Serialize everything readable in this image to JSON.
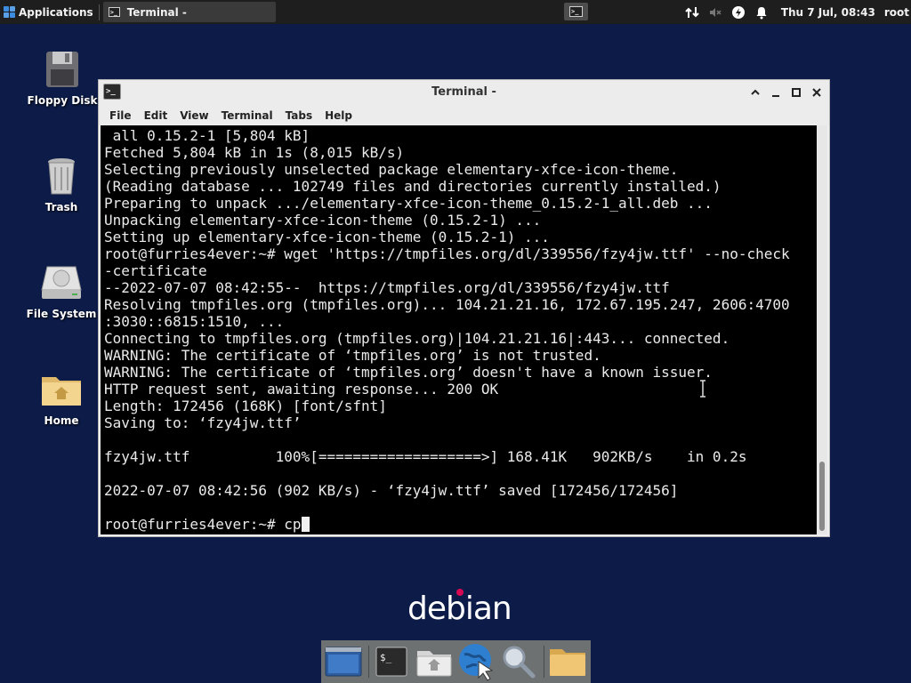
{
  "top_panel": {
    "applications_label": "Applications",
    "task_label": "Terminal -",
    "clock": "Thu 7 Jul, 08:43",
    "user": "root",
    "tray_icons": [
      "network-icon",
      "volume-muted-icon",
      "power-icon",
      "notification-bell-icon"
    ]
  },
  "desktop_icons": [
    {
      "label": "Floppy Disk",
      "icon": "floppy-disk-icon"
    },
    {
      "label": "Trash",
      "icon": "trash-icon"
    },
    {
      "label": "File System",
      "icon": "hard-drive-icon"
    },
    {
      "label": "Home",
      "icon": "home-folder-icon"
    }
  ],
  "window": {
    "title": "Terminal -",
    "menu": [
      "File",
      "Edit",
      "View",
      "Terminal",
      "Tabs",
      "Help"
    ],
    "terminal_lines": [
      " all 0.15.2-1 [5,804 kB]",
      "Fetched 5,804 kB in 1s (8,015 kB/s)",
      "Selecting previously unselected package elementary-xfce-icon-theme.",
      "(Reading database ... 102749 files and directories currently installed.)",
      "Preparing to unpack .../elementary-xfce-icon-theme_0.15.2-1_all.deb ...",
      "Unpacking elementary-xfce-icon-theme (0.15.2-1) ...",
      "Setting up elementary-xfce-icon-theme (0.15.2-1) ...",
      "root@furries4ever:~# wget 'https://tmpfiles.org/dl/339556/fzy4jw.ttf' --no-check",
      "-certificate",
      "--2022-07-07 08:42:55--  https://tmpfiles.org/dl/339556/fzy4jw.ttf",
      "Resolving tmpfiles.org (tmpfiles.org)... 104.21.21.16, 172.67.195.247, 2606:4700",
      ":3030::6815:1510, ...",
      "Connecting to tmpfiles.org (tmpfiles.org)|104.21.21.16|:443... connected.",
      "WARNING: The certificate of ‘tmpfiles.org’ is not trusted.",
      "WARNING: The certificate of ‘tmpfiles.org’ doesn't have a known issuer.",
      "HTTP request sent, awaiting response... 200 OK",
      "Length: 172456 (168K) [font/sfnt]",
      "Saving to: ‘fzy4jw.ttf’",
      "",
      "fzy4jw.ttf          100%[===================>] 168.41K   902KB/s    in 0.2s",
      "",
      "2022-07-07 08:42:56 (902 KB/s) - ‘fzy4jw.ttf’ saved [172456/172456]",
      ""
    ],
    "prompt_line": "root@furries4ever:~# cp"
  },
  "logo_text": "debian",
  "dock": {
    "items": [
      "show-desktop-icon",
      "terminal-icon",
      "file-manager-icon",
      "web-browser-icon",
      "app-finder-icon",
      "folder-icon"
    ]
  }
}
